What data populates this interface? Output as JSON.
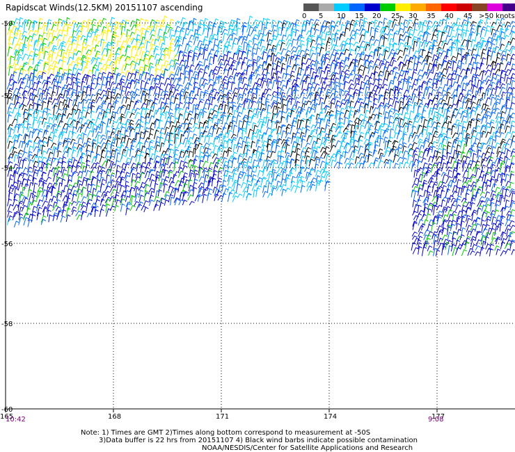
{
  "title": "Rapidscat Winds(12.5KM) 20151107 ascending",
  "legend": {
    "labels": [
      "0",
      "5",
      "10",
      "15",
      "20",
      "25",
      "30",
      "35",
      "40",
      "45",
      ">50 knots"
    ],
    "colors": [
      "#555555",
      "#aaaaaa",
      "#00ccff",
      "#0066ff",
      "#0000cc",
      "#00cc00",
      "#ffee00",
      "#ffaa00",
      "#ff6600",
      "#ff0000",
      "#cc0000",
      "#884422",
      "#dd00dd",
      "#440088"
    ]
  },
  "map": {
    "lat_labels": [
      "-50",
      "-52",
      "-54",
      "-56",
      "-58",
      "-60"
    ],
    "lon_labels": [
      "165",
      "168",
      "171",
      "174",
      "177"
    ]
  },
  "times": {
    "left": "10:42",
    "right": "9:08"
  },
  "notes": {
    "line1": "Note: 1) Times are GMT 2)Times along bottom correspond to measurement at -50S",
    "line2": "3)Data buffer is 22 hrs from 20151107 4) Black wind barbs indicate possible contamination",
    "line3": "NOAA/NESDIS/Center for Satellite Applications and Research"
  }
}
